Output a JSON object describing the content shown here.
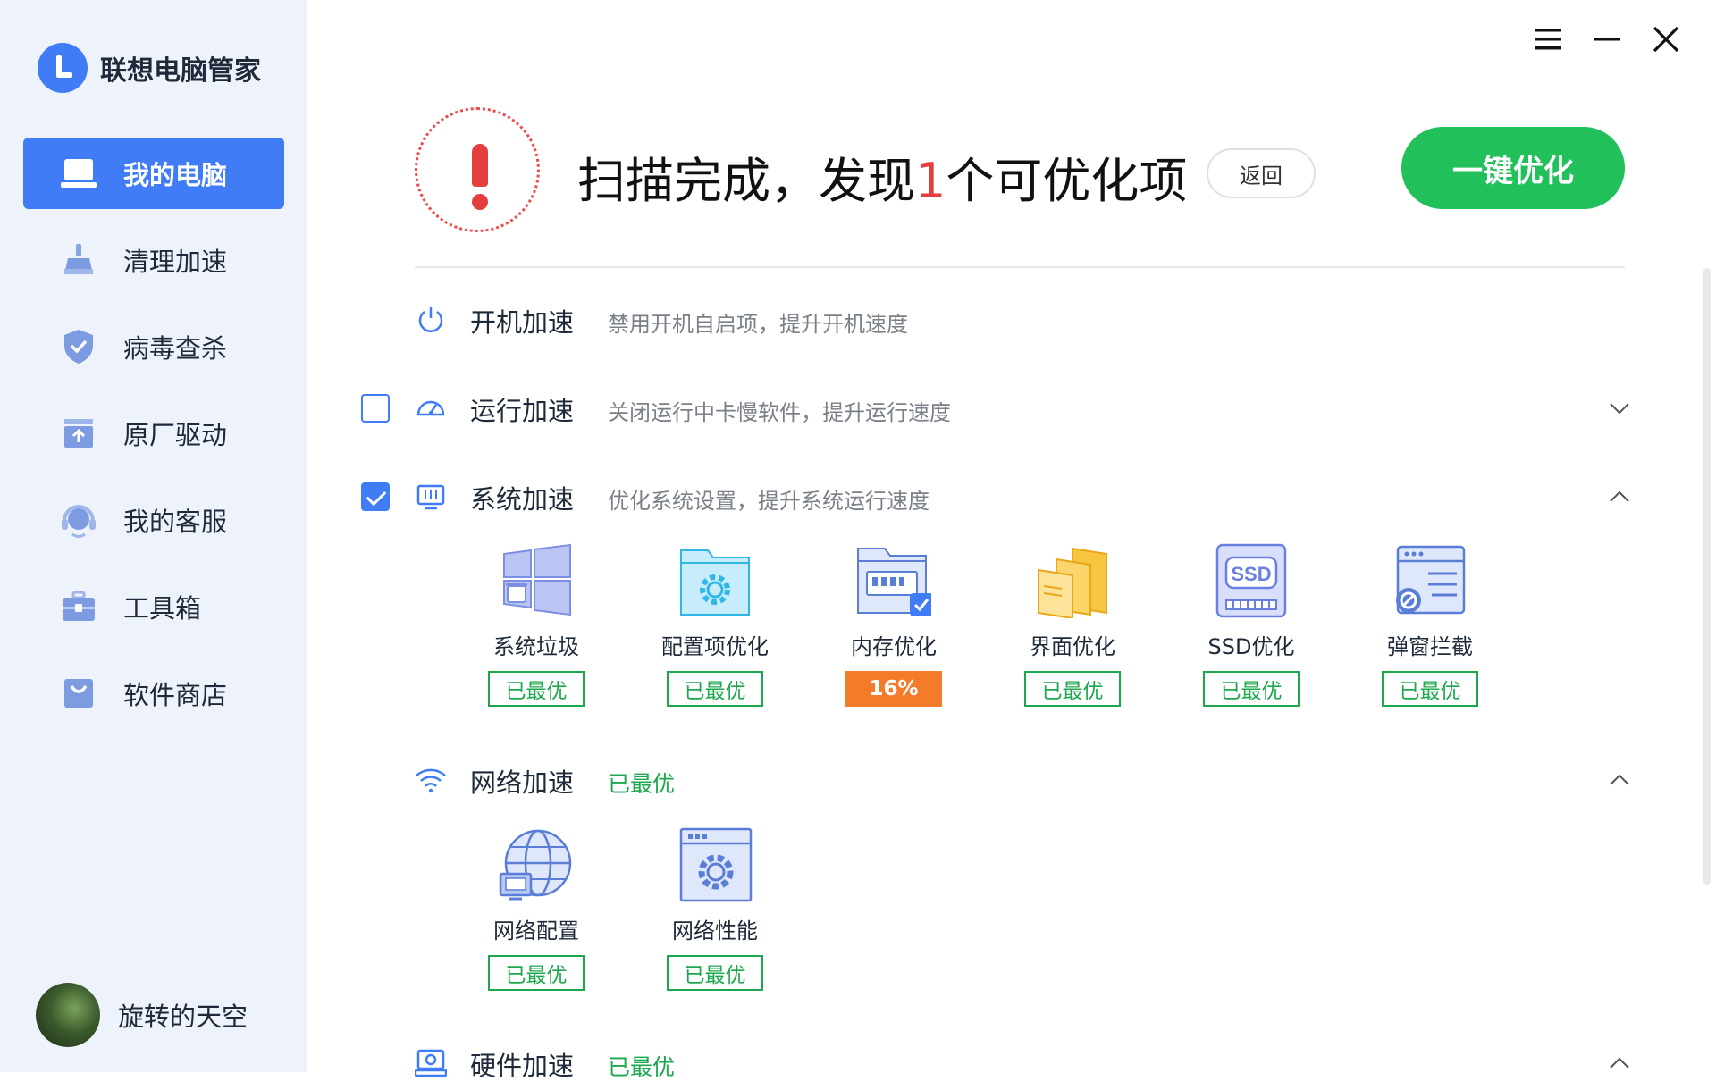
{
  "app": {
    "name": "联想电脑管家"
  },
  "sidebar": {
    "items": [
      {
        "label": "我的电脑",
        "icon": "laptop-icon",
        "active": true
      },
      {
        "label": "清理加速",
        "icon": "broom-icon"
      },
      {
        "label": "病毒查杀",
        "icon": "shield-icon"
      },
      {
        "label": "原厂驱动",
        "icon": "driver-box-icon"
      },
      {
        "label": "我的客服",
        "icon": "headset-icon"
      },
      {
        "label": "工具箱",
        "icon": "toolbox-icon"
      },
      {
        "label": "软件商店",
        "icon": "store-bag-icon"
      }
    ],
    "user": {
      "name": "旋转的天空"
    }
  },
  "header": {
    "title_before": "扫描完成，发现",
    "count": "1",
    "title_after": "个可优化项",
    "back_label": "返回",
    "optimize_label": "一键优化"
  },
  "sections": {
    "startup": {
      "title": "开机加速",
      "desc": "禁用开机自启项，提升开机速度"
    },
    "runtime": {
      "title": "运行加速",
      "desc": "关闭运行中卡慢软件，提升运行速度",
      "checked": false
    },
    "system": {
      "title": "系统加速",
      "desc": "优化系统设置，提升系统运行速度",
      "checked": true,
      "tiles": [
        {
          "label": "系统垃圾",
          "status": "已最优"
        },
        {
          "label": "配置项优化",
          "status": "已最优"
        },
        {
          "label": "内存优化",
          "status": "16%"
        },
        {
          "label": "界面优化",
          "status": "已最优"
        },
        {
          "label": "SSD优化",
          "status": "已最优"
        },
        {
          "label": "弹窗拦截",
          "status": "已最优"
        }
      ]
    },
    "network": {
      "title": "网络加速",
      "desc": "已最优",
      "tiles": [
        {
          "label": "网络配置",
          "status": "已最优"
        },
        {
          "label": "网络性能",
          "status": "已最优"
        }
      ]
    },
    "hardware": {
      "title": "硬件加速",
      "desc": "已最优"
    }
  },
  "tile_icons": {
    "ssd_text": "SSD"
  },
  "colors": {
    "accent": "#3f7cf5",
    "success": "#1ea84e",
    "warning": "#f47b28",
    "danger": "#e53e3e",
    "button_green": "#21c05a"
  }
}
